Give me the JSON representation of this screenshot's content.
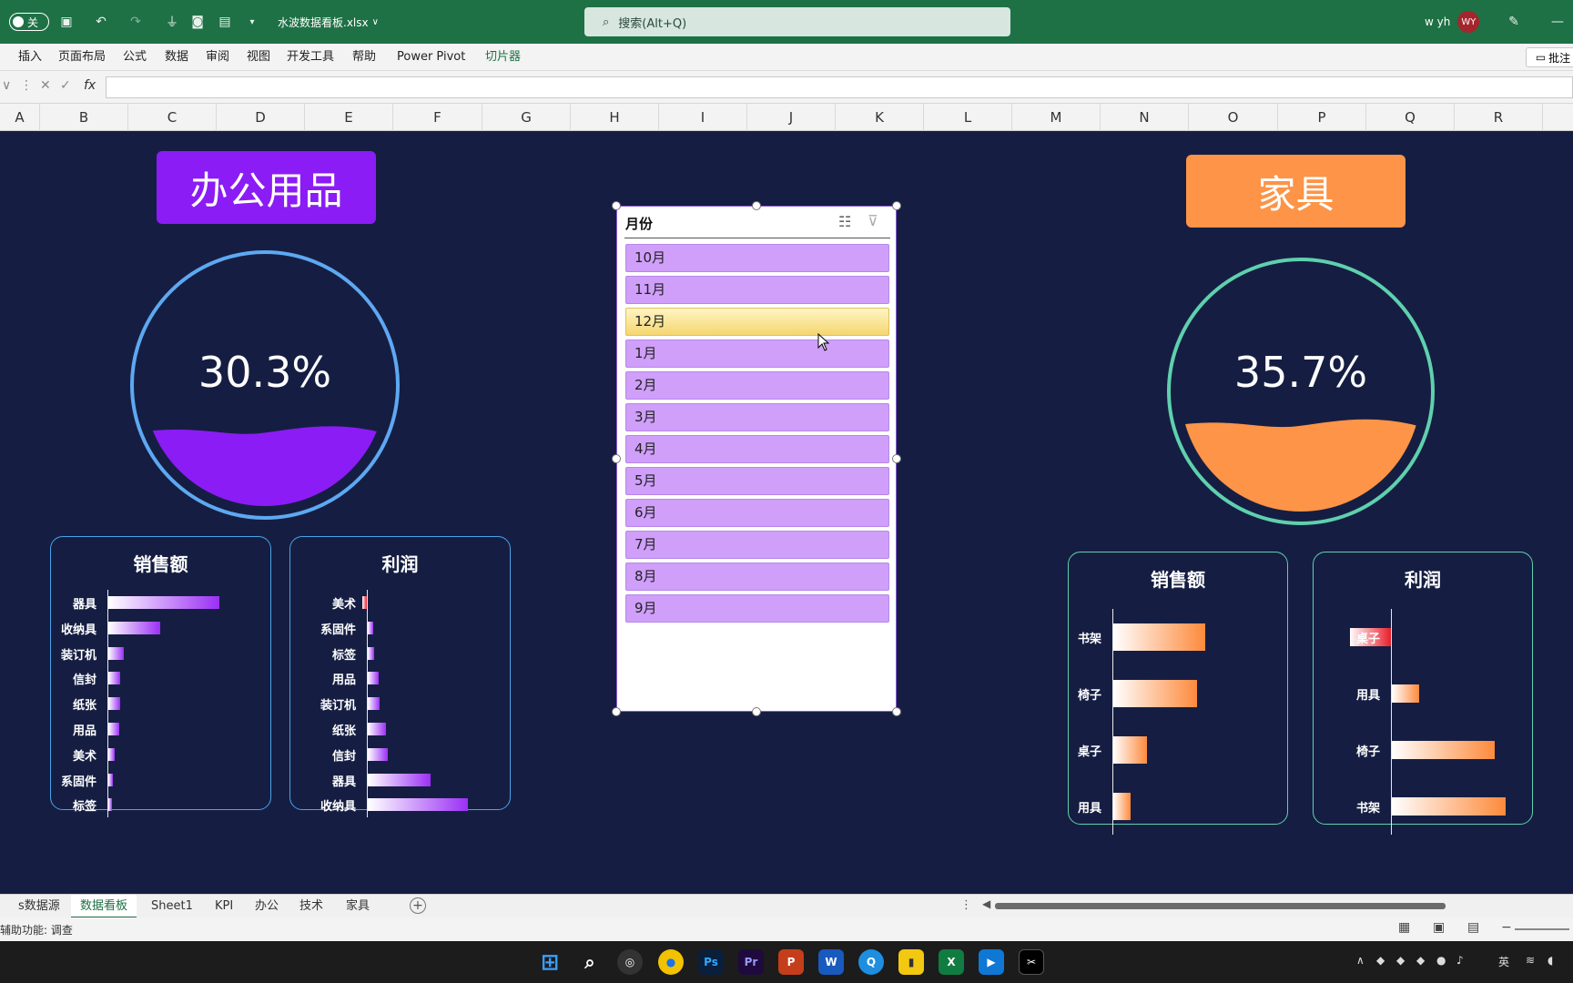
{
  "titlebar": {
    "autosave_label": "关",
    "filename": "水波数据看板.xlsx",
    "search_placeholder": "搜索(Alt+Q)",
    "user_name": "w yh",
    "avatar_initials": "WY"
  },
  "ribbon": {
    "tabs": [
      "插入",
      "页面布局",
      "公式",
      "数据",
      "审阅",
      "视图",
      "开发工具",
      "帮助",
      "Power Pivot",
      "切片器"
    ],
    "comment_label": "批注"
  },
  "formula": {
    "fx_label": "fx"
  },
  "columns": [
    "A",
    "B",
    "C",
    "D",
    "E",
    "F",
    "G",
    "H",
    "I",
    "J",
    "K",
    "L",
    "M",
    "N",
    "O",
    "P",
    "Q",
    "R"
  ],
  "dashboard": {
    "office": {
      "title": "办公用品",
      "percent": "30.3%",
      "fill_fraction": 0.303,
      "title_color": "#8b1cf5",
      "ring_color": "#5ea8f2",
      "wave_color": "#8b1cf5",
      "sales": {
        "title": "销售额",
        "labels": [
          "器具",
          "收纳具",
          "装订机",
          "信封",
          "纸张",
          "用品",
          "美术",
          "系固件",
          "标签"
        ],
        "values": [
          100,
          47,
          14,
          11,
          11,
          10,
          6,
          4,
          3
        ]
      },
      "profit": {
        "title": "利润",
        "labels": [
          "美术",
          "系固件",
          "标签",
          "用品",
          "装订机",
          "纸张",
          "信封",
          "器具",
          "收纳具"
        ],
        "values": [
          -5,
          5,
          6,
          11,
          12,
          18,
          20,
          63,
          100
        ]
      }
    },
    "furniture": {
      "title": "家具",
      "percent": "35.7%",
      "fill_fraction": 0.357,
      "title_color": "#fd9447",
      "ring_color": "#5fd0ae",
      "wave_color": "#fd9447",
      "sales": {
        "title": "销售额",
        "labels": [
          "书架",
          "椅子",
          "桌子",
          "用具"
        ],
        "values": [
          100,
          91,
          37,
          19
        ]
      },
      "profit": {
        "title": "利润",
        "labels": [
          "桌子",
          "用具",
          "椅子",
          "书架"
        ],
        "values": [
          -36,
          24,
          90,
          100
        ]
      }
    }
  },
  "slicer": {
    "title": "月份",
    "items": [
      "10月",
      "11月",
      "12月",
      "1月",
      "2月",
      "3月",
      "4月",
      "5月",
      "6月",
      "7月",
      "8月",
      "9月"
    ],
    "selected": "12月"
  },
  "sheet_tabs": [
    "s数据源",
    "数据看板",
    "Sheet1",
    "KPI",
    "办公",
    "技术",
    "家具"
  ],
  "active_sheet": "数据看板",
  "status": {
    "accessibility": "辅助功能: 调查"
  },
  "tray": {
    "ime": "英"
  }
}
